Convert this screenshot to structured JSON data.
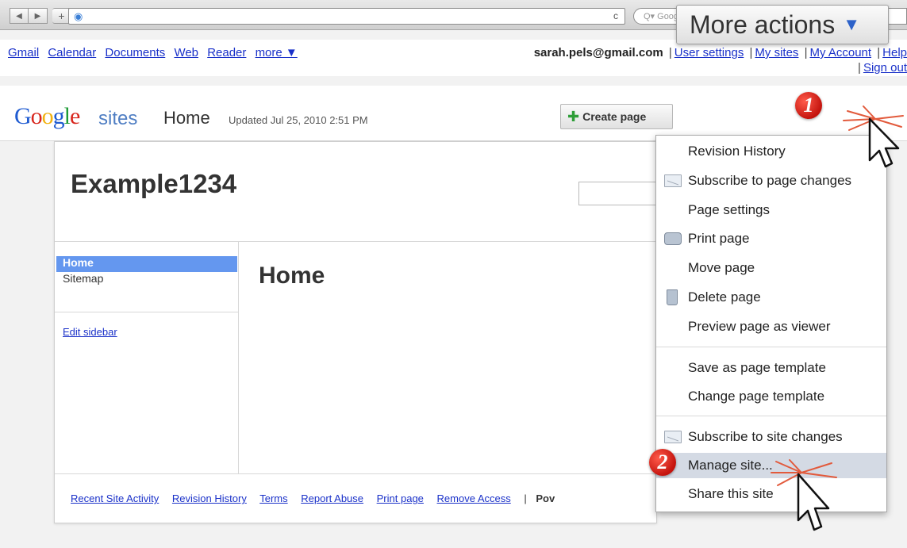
{
  "browser": {
    "back_glyph": "◀",
    "forward_glyph": "▶",
    "add_glyph": "+",
    "url_value": "",
    "reload_glyph": "c",
    "search_placeholder": "Q▾ Google"
  },
  "gbar": {
    "links": [
      "Gmail",
      "Calendar",
      "Documents",
      "Web",
      "Reader"
    ],
    "more_label": "more ▼",
    "email": "sarah.pels@gmail.com",
    "sep": "|",
    "user_settings": "User settings",
    "my_sites": "My sites",
    "my_account": "My Account",
    "help": "Help",
    "sign_out": "Sign out"
  },
  "header": {
    "logo": {
      "g": "G",
      "o1": "o",
      "o2": "o",
      "g2": "g",
      "l": "l",
      "e": "e"
    },
    "sites_label": "sites",
    "page_name": "Home",
    "updated": "Updated Jul 25, 2010 2:51 PM",
    "create_plus": "✚",
    "create_label": "Create page",
    "more_actions_label": "More actions",
    "more_actions_arrow": "▼"
  },
  "site": {
    "title": "Example1234",
    "search_value": "",
    "sidebar": {
      "home": "Home",
      "sitemap": "Sitemap",
      "edit": "Edit sidebar"
    },
    "page_heading": "Home",
    "footer": {
      "links": [
        "Recent Site Activity",
        "Revision History",
        "Terms",
        "Report Abuse",
        "Print page",
        "Remove Access"
      ],
      "sep": "|",
      "powered": "Pov"
    }
  },
  "menu": {
    "items": [
      {
        "label": "Revision History",
        "icon": ""
      },
      {
        "label": "Subscribe to page changes",
        "icon": "envelope-icon"
      },
      {
        "label": "Page settings",
        "icon": ""
      },
      {
        "label": "Print page",
        "icon": "printer-icon"
      },
      {
        "label": "Move page",
        "icon": ""
      },
      {
        "label": "Delete page",
        "icon": "trash-icon"
      },
      {
        "label": "Preview page as viewer",
        "icon": ""
      },
      {
        "label": "Save as page template",
        "icon": ""
      },
      {
        "label": "Change page template",
        "icon": ""
      },
      {
        "label": "Subscribe to site changes",
        "icon": "envelope-icon"
      },
      {
        "label": "Manage site...",
        "icon": ""
      },
      {
        "label": "Share this site",
        "icon": ""
      }
    ],
    "hover_color": "#d4dae4"
  },
  "annotations": {
    "step1": "1",
    "step2": "2",
    "marker_color": "#d41d12"
  }
}
